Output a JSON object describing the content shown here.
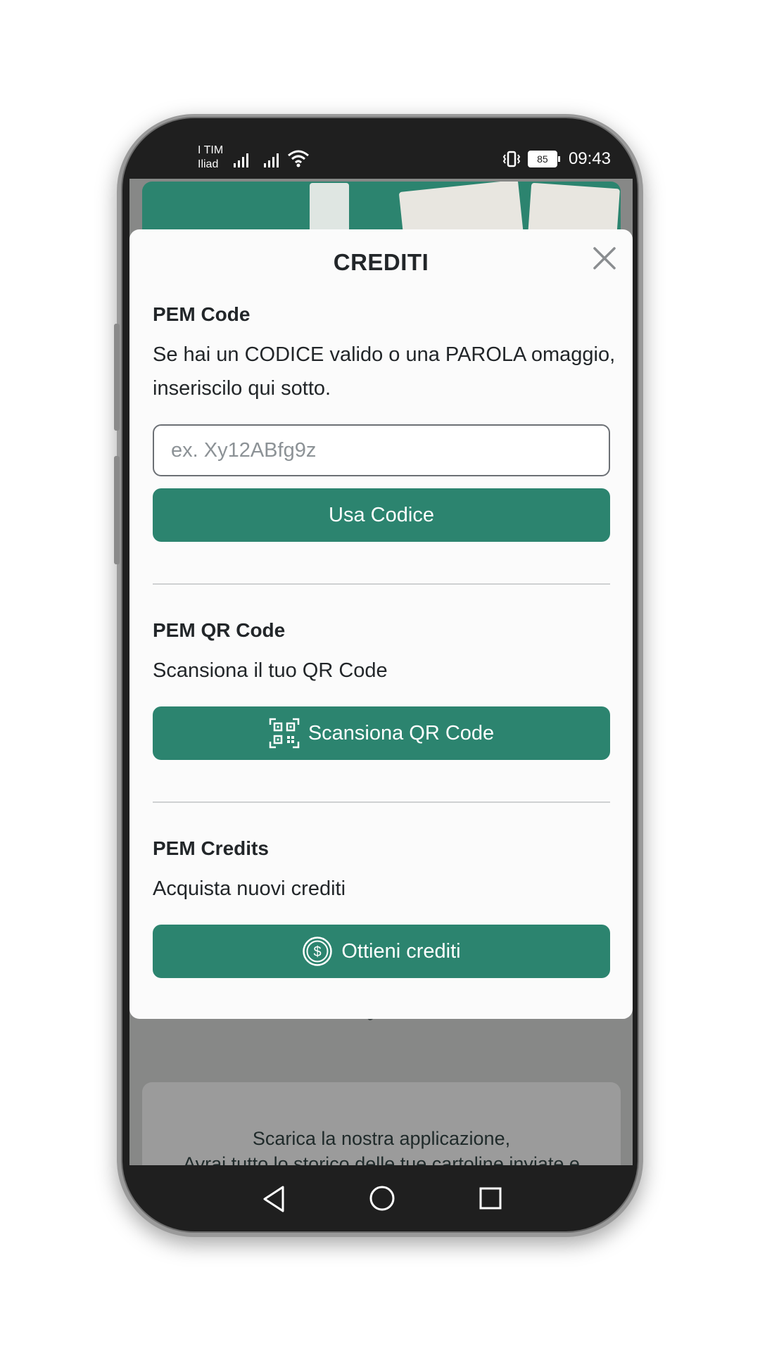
{
  "status_bar": {
    "carrier_1": "I TIM",
    "carrier_2": "Iliad",
    "battery": "85",
    "time": "09:43"
  },
  "background": {
    "app_promo_line1": "Scarica la nostra applicazione,",
    "app_promo_line2": "Avrai tutto lo storico delle tue cartoline inviate e"
  },
  "modal": {
    "title": "CREDITI",
    "pem_code": {
      "title": "PEM Code",
      "description": "Se hai un CODICE valido o una PAROLA omaggio, inseriscilo qui sotto.",
      "input_placeholder": "ex. Xy12ABfg9z",
      "input_value": "",
      "button_label": "Usa Codice"
    },
    "pem_qr": {
      "title": "PEM QR Code",
      "description": "Scansiona il tuo QR Code",
      "button_label": "Scansiona QR Code",
      "button_icon": "qr-code-icon"
    },
    "pem_credits": {
      "title": "PEM Credits",
      "description": "Acquista nuovi crediti",
      "button_label": "Ottieni crediti",
      "button_icon": "dollar-coin-icon"
    }
  },
  "colors": {
    "accent": "#2c846f",
    "overlay": "#878887",
    "modal_bg": "#fbfbfb"
  }
}
